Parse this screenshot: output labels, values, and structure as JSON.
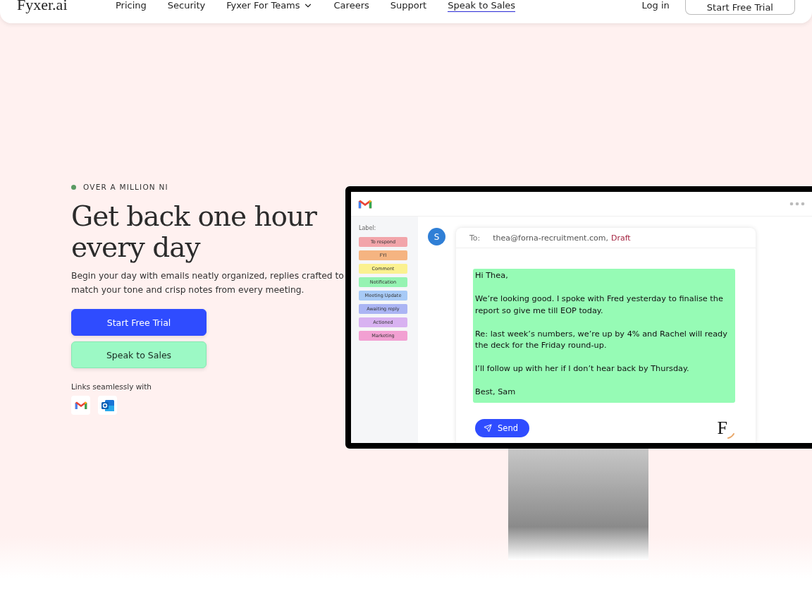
{
  "nav": {
    "logo": "Fyxer.ai",
    "links": [
      {
        "label": "Pricing",
        "dropdown": false,
        "selected": false
      },
      {
        "label": "Security",
        "dropdown": false,
        "selected": false
      },
      {
        "label": "Fyxer For Teams",
        "dropdown": true,
        "selected": false
      },
      {
        "label": "Careers",
        "dropdown": false,
        "selected": false
      },
      {
        "label": "Support",
        "dropdown": false,
        "selected": false
      },
      {
        "label": "Speak to Sales",
        "dropdown": false,
        "selected": true
      }
    ],
    "login": "Log in",
    "cta": "Start Free Trial"
  },
  "hero": {
    "eyebrow": "OVER A MILLION NI",
    "title": "Get back one hour every day",
    "subtitle": "Begin your day with emails neatly organized, replies crafted to match your tone and crisp notes from every meeting.",
    "primary_button": "Start Free Trial",
    "secondary_button": "Speak to Sales",
    "links_caption": "Links seamlessly with"
  },
  "mockup": {
    "label_heading": "Label:",
    "labels": [
      {
        "text": "To respond",
        "color": "#f2a5aa"
      },
      {
        "text": "FYI",
        "color": "#f5b481"
      },
      {
        "text": "Comment",
        "color": "#fbf190"
      },
      {
        "text": "Notification",
        "color": "#95f3b2"
      },
      {
        "text": "Meeting Update",
        "color": "#a7caf6"
      },
      {
        "text": "Awaiting reply",
        "color": "#abb5f4"
      },
      {
        "text": "Actioned",
        "color": "#d8b2f1"
      },
      {
        "text": "Marketing",
        "color": "#f2a0d2"
      }
    ],
    "avatar": "S",
    "to_label": "To:",
    "recipient": "thea@forna-recruitment.com,",
    "status": "Draft",
    "body": [
      "Hi Thea,",
      "We’re looking good. I spoke with Fred yesterday to finalise the report so give me till EOP today.",
      "Re: last week’s numbers, we’re up by 4% and Rachel will ready the deck for the Friday round-up.",
      "I’ll follow up with her if I don’t hear back by Thursday.",
      "Best, Sam"
    ],
    "send": "Send",
    "brand_mark": "F"
  }
}
